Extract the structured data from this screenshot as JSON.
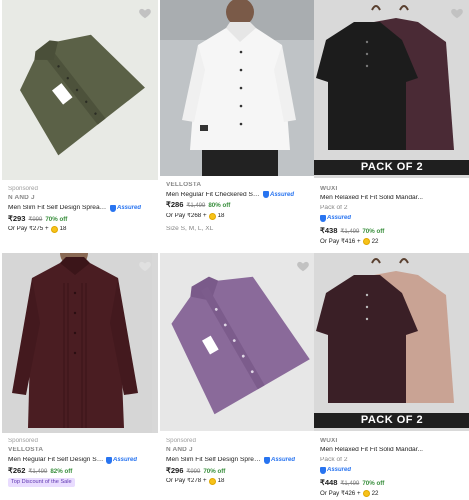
{
  "products": [
    {
      "sponsored": "Sponsored",
      "brand": "N AND J",
      "title": "Men Slim Fit Self Design Spread ...",
      "assured": "Assured",
      "price": "₹293",
      "mrp": "₹999",
      "off": "70% off",
      "or_pay": "Or Pay ₹275 +",
      "coins": "18",
      "colors": {
        "bg": "#e7e9e4",
        "shirt": "#5b6147"
      }
    },
    {
      "brand": "VELLOSTA",
      "title": "Men Regular Fit Checkered Spread ...",
      "assured": "Assured",
      "price": "₹286",
      "mrp": "₹1,499",
      "off": "80% off",
      "or_pay": "Or Pay ₹268 +",
      "coins": "18",
      "size": "Size S, M, L, XL",
      "colors": {
        "bg": "#dcdcdc",
        "shirt": "#f6f6f6"
      }
    },
    {
      "brand": "WUXI",
      "title": "Men Relaxed Fit Fit Solid Mandar...",
      "pack_label": "Pack of 2",
      "assured": "Assured",
      "price": "₹438",
      "mrp": "₹1,499",
      "off": "70% off",
      "or_pay": "Or Pay ₹416 +",
      "coins": "22",
      "banner": "PACK OF 2",
      "colors": {
        "bg": "#d9d9d9",
        "shirt": "#1c1c1c",
        "shirt2": "#4a2a35"
      }
    },
    {
      "sponsored": "Sponsored",
      "brand": "VELLOSTA",
      "title": "Men Regular Fit Self Design Spre...",
      "assured": "Assured",
      "price": "₹262",
      "mrp": "₹1,499",
      "off": "82% off",
      "tag": "Top Discount of the Sale",
      "colors": {
        "bg": "#d8d8d8",
        "shirt": "#4a1d22"
      }
    },
    {
      "sponsored": "Sponsored",
      "brand": "N AND J",
      "title": "Men Slim Fit Self Design Spread ...",
      "assured": "Assured",
      "price": "₹296",
      "mrp": "₹999",
      "off": "70% off",
      "or_pay": "Or Pay ₹278 +",
      "coins": "18",
      "colors": {
        "bg": "#e7e7e7",
        "shirt": "#8a6a9a"
      }
    },
    {
      "brand": "WUXI",
      "title": "Men Relaxed Fit Fit Solid Mandar...",
      "pack_label": "Pack of 2",
      "assured": "Assured",
      "price": "₹448",
      "mrp": "₹1,499",
      "off": "70% off",
      "or_pay": "Or Pay ₹426 +",
      "coins": "22",
      "banner": "PACK OF 2",
      "colors": {
        "bg": "#d9d9d9",
        "shirt": "#3a1f26",
        "shirt2": "#c9a394"
      }
    }
  ]
}
